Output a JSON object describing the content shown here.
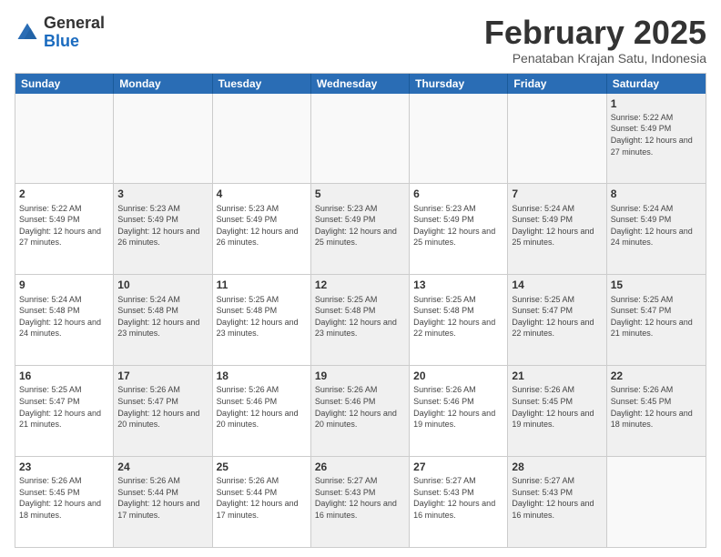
{
  "logo": {
    "general": "General",
    "blue": "Blue"
  },
  "title": "February 2025",
  "subtitle": "Penataban Krajan Satu, Indonesia",
  "headers": [
    "Sunday",
    "Monday",
    "Tuesday",
    "Wednesday",
    "Thursday",
    "Friday",
    "Saturday"
  ],
  "weeks": [
    [
      {
        "day": "",
        "info": "",
        "empty": true
      },
      {
        "day": "",
        "info": "",
        "empty": true
      },
      {
        "day": "",
        "info": "",
        "empty": true
      },
      {
        "day": "",
        "info": "",
        "empty": true
      },
      {
        "day": "",
        "info": "",
        "empty": true
      },
      {
        "day": "",
        "info": "",
        "empty": true
      },
      {
        "day": "1",
        "info": "Sunrise: 5:22 AM\nSunset: 5:49 PM\nDaylight: 12 hours\nand 27 minutes.",
        "shaded": true
      }
    ],
    [
      {
        "day": "2",
        "info": "Sunrise: 5:22 AM\nSunset: 5:49 PM\nDaylight: 12 hours\nand 27 minutes."
      },
      {
        "day": "3",
        "info": "Sunrise: 5:23 AM\nSunset: 5:49 PM\nDaylight: 12 hours\nand 26 minutes.",
        "shaded": true
      },
      {
        "day": "4",
        "info": "Sunrise: 5:23 AM\nSunset: 5:49 PM\nDaylight: 12 hours\nand 26 minutes."
      },
      {
        "day": "5",
        "info": "Sunrise: 5:23 AM\nSunset: 5:49 PM\nDaylight: 12 hours\nand 25 minutes.",
        "shaded": true
      },
      {
        "day": "6",
        "info": "Sunrise: 5:23 AM\nSunset: 5:49 PM\nDaylight: 12 hours\nand 25 minutes."
      },
      {
        "day": "7",
        "info": "Sunrise: 5:24 AM\nSunset: 5:49 PM\nDaylight: 12 hours\nand 25 minutes.",
        "shaded": true
      },
      {
        "day": "8",
        "info": "Sunrise: 5:24 AM\nSunset: 5:49 PM\nDaylight: 12 hours\nand 24 minutes.",
        "shaded": true
      }
    ],
    [
      {
        "day": "9",
        "info": "Sunrise: 5:24 AM\nSunset: 5:48 PM\nDaylight: 12 hours\nand 24 minutes."
      },
      {
        "day": "10",
        "info": "Sunrise: 5:24 AM\nSunset: 5:48 PM\nDaylight: 12 hours\nand 23 minutes.",
        "shaded": true
      },
      {
        "day": "11",
        "info": "Sunrise: 5:25 AM\nSunset: 5:48 PM\nDaylight: 12 hours\nand 23 minutes."
      },
      {
        "day": "12",
        "info": "Sunrise: 5:25 AM\nSunset: 5:48 PM\nDaylight: 12 hours\nand 23 minutes.",
        "shaded": true
      },
      {
        "day": "13",
        "info": "Sunrise: 5:25 AM\nSunset: 5:48 PM\nDaylight: 12 hours\nand 22 minutes."
      },
      {
        "day": "14",
        "info": "Sunrise: 5:25 AM\nSunset: 5:47 PM\nDaylight: 12 hours\nand 22 minutes.",
        "shaded": true
      },
      {
        "day": "15",
        "info": "Sunrise: 5:25 AM\nSunset: 5:47 PM\nDaylight: 12 hours\nand 21 minutes.",
        "shaded": true
      }
    ],
    [
      {
        "day": "16",
        "info": "Sunrise: 5:25 AM\nSunset: 5:47 PM\nDaylight: 12 hours\nand 21 minutes."
      },
      {
        "day": "17",
        "info": "Sunrise: 5:26 AM\nSunset: 5:47 PM\nDaylight: 12 hours\nand 20 minutes.",
        "shaded": true
      },
      {
        "day": "18",
        "info": "Sunrise: 5:26 AM\nSunset: 5:46 PM\nDaylight: 12 hours\nand 20 minutes."
      },
      {
        "day": "19",
        "info": "Sunrise: 5:26 AM\nSunset: 5:46 PM\nDaylight: 12 hours\nand 20 minutes.",
        "shaded": true
      },
      {
        "day": "20",
        "info": "Sunrise: 5:26 AM\nSunset: 5:46 PM\nDaylight: 12 hours\nand 19 minutes."
      },
      {
        "day": "21",
        "info": "Sunrise: 5:26 AM\nSunset: 5:45 PM\nDaylight: 12 hours\nand 19 minutes.",
        "shaded": true
      },
      {
        "day": "22",
        "info": "Sunrise: 5:26 AM\nSunset: 5:45 PM\nDaylight: 12 hours\nand 18 minutes.",
        "shaded": true
      }
    ],
    [
      {
        "day": "23",
        "info": "Sunrise: 5:26 AM\nSunset: 5:45 PM\nDaylight: 12 hours\nand 18 minutes."
      },
      {
        "day": "24",
        "info": "Sunrise: 5:26 AM\nSunset: 5:44 PM\nDaylight: 12 hours\nand 17 minutes.",
        "shaded": true
      },
      {
        "day": "25",
        "info": "Sunrise: 5:26 AM\nSunset: 5:44 PM\nDaylight: 12 hours\nand 17 minutes."
      },
      {
        "day": "26",
        "info": "Sunrise: 5:27 AM\nSunset: 5:43 PM\nDaylight: 12 hours\nand 16 minutes.",
        "shaded": true
      },
      {
        "day": "27",
        "info": "Sunrise: 5:27 AM\nSunset: 5:43 PM\nDaylight: 12 hours\nand 16 minutes."
      },
      {
        "day": "28",
        "info": "Sunrise: 5:27 AM\nSunset: 5:43 PM\nDaylight: 12 hours\nand 16 minutes.",
        "shaded": true
      },
      {
        "day": "",
        "info": "",
        "empty": true
      }
    ]
  ]
}
